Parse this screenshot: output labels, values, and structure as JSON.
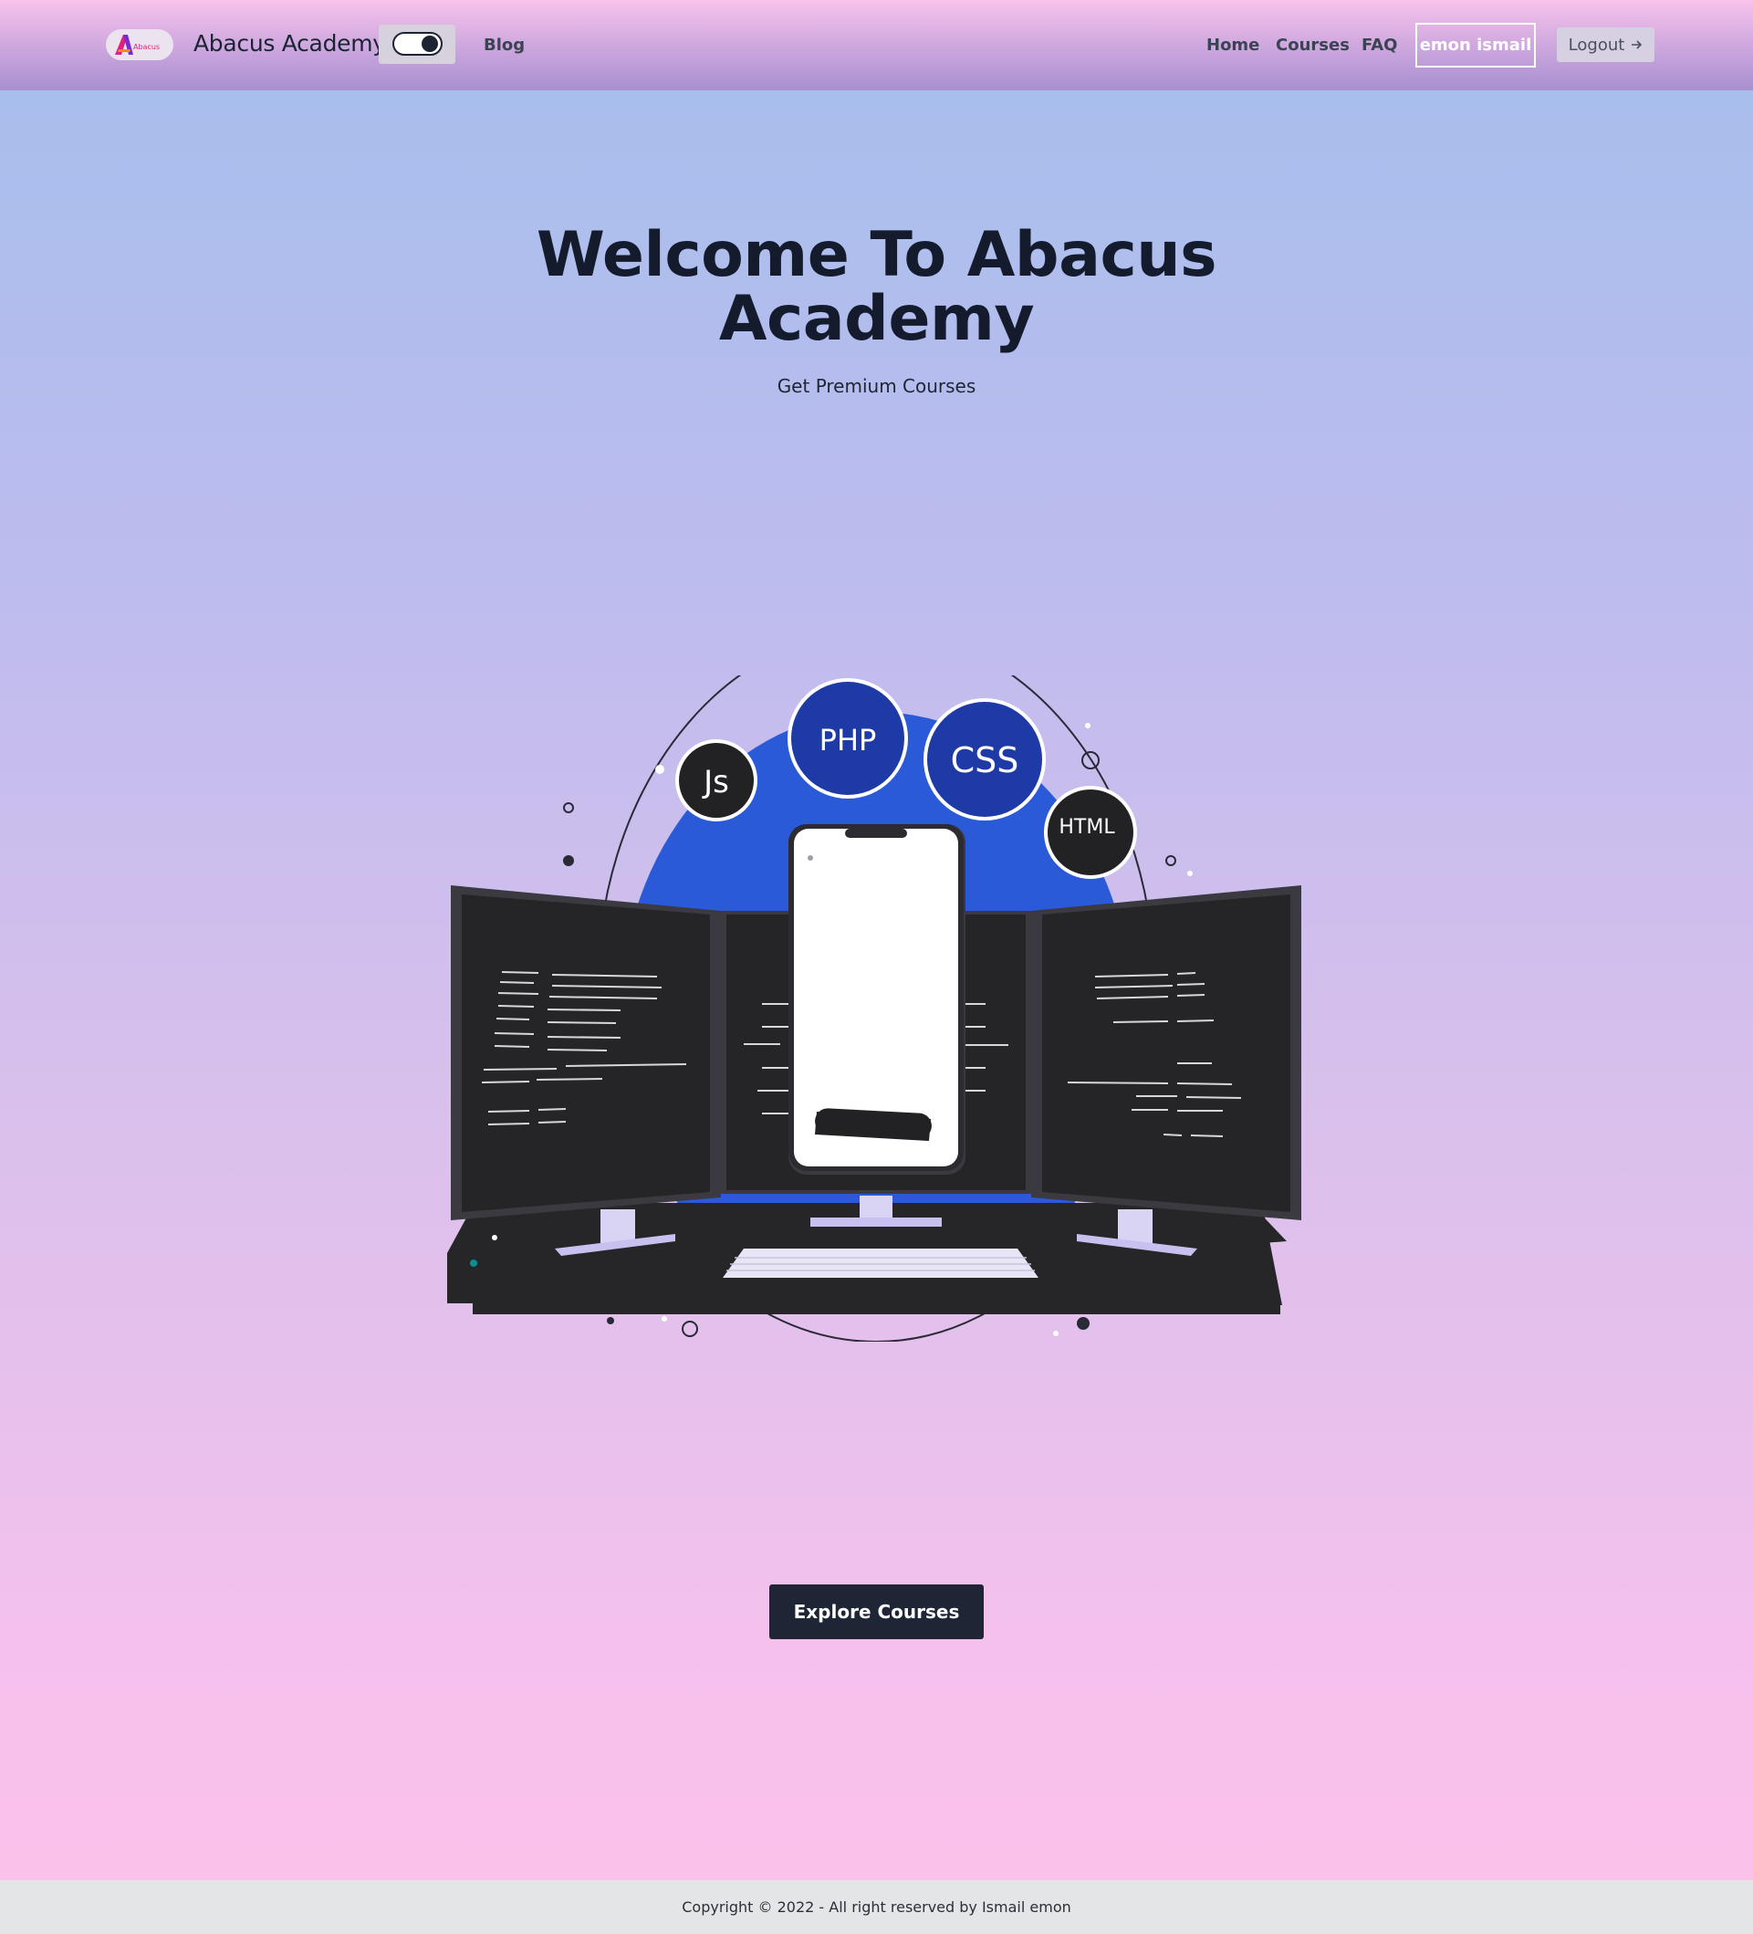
{
  "navbar": {
    "logo_text": "Abacus",
    "brand": "Abacus Academy",
    "links": [
      "Blog",
      "Home",
      "Courses",
      "FAQ"
    ],
    "user_name": "emon ismail",
    "logout_label": "Logout",
    "theme_toggle_state": "dark"
  },
  "hero": {
    "title": "Welcome To Abacus Academy",
    "subtitle": "Get Premium Courses",
    "badges": [
      "Js",
      "PHP",
      "CSS",
      "HTML"
    ],
    "cta_label": "Explore Courses"
  },
  "footer": {
    "copyright": "Copyright © 2022 - All right reserved by Ismail emon"
  },
  "colors": {
    "dark": "#1e2535",
    "badge_blue": "#1d3aa7",
    "orbit_blue": "#2a5ad8",
    "screen": "#252528"
  }
}
